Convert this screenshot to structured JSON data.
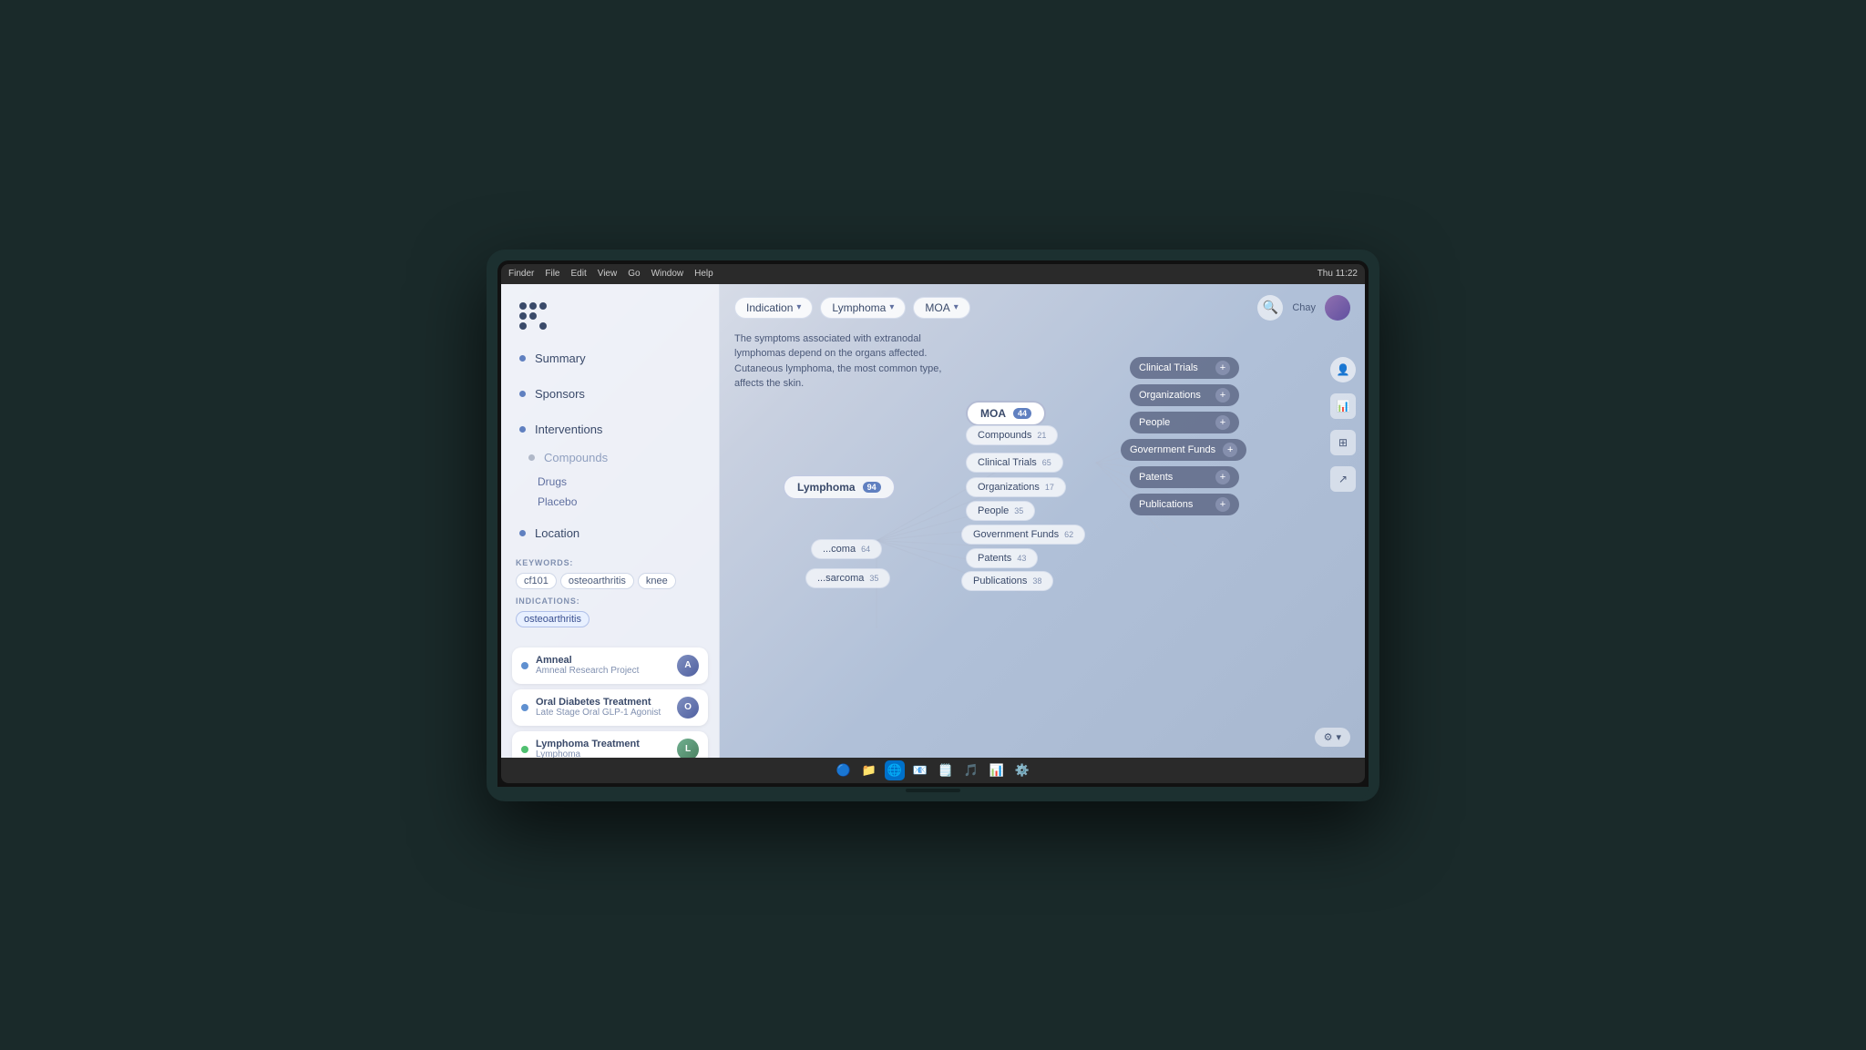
{
  "macos": {
    "menu_items": [
      "Finder",
      "File",
      "Edit",
      "View",
      "Go",
      "Window",
      "Help"
    ],
    "status_right": [
      "Thu 11:22"
    ]
  },
  "sidebar": {
    "nav_items": [
      {
        "label": "Summary",
        "dot": "blue",
        "id": "summary"
      },
      {
        "label": "Sponsors",
        "dot": "blue",
        "id": "sponsors"
      },
      {
        "label": "Interventions",
        "dot": "blue",
        "id": "interventions"
      },
      {
        "label": "Compounds",
        "dot": "gray",
        "id": "compounds"
      },
      {
        "label": "Drugs",
        "dot": "none",
        "id": "drugs"
      },
      {
        "label": "Placebo",
        "dot": "none",
        "id": "placebo"
      },
      {
        "label": "Location",
        "dot": "blue",
        "id": "location"
      }
    ],
    "keywords_label": "KEYWORDS:",
    "keywords": [
      "cf101",
      "osteoarthritis",
      "knee"
    ],
    "indications_label": "INDICATIONS:",
    "indications": [
      "osteoarthritis"
    ],
    "projects": [
      {
        "title": "Amneal",
        "sub": "Amneal Research Project",
        "dot": "blue",
        "avatar": "A"
      },
      {
        "title": "Oral Diabetes Treatment",
        "sub": "Late Stage Oral GLP-1 Agonist",
        "dot": "blue",
        "avatar": "O"
      },
      {
        "title": "Lymphoma Treatment",
        "sub": "Lymphoma",
        "dot": "green",
        "avatar": "L"
      }
    ]
  },
  "header": {
    "filters": [
      {
        "label": "Indication",
        "id": "indication-filter"
      },
      {
        "label": "Lymphoma",
        "id": "lymphoma-filter"
      },
      {
        "label": "MOA",
        "id": "moa-filter"
      }
    ],
    "search_placeholder": "Search",
    "user_name": "Chay"
  },
  "description": {
    "text": "The symptoms associated with extranodal lymphomas depend on the organs affected. Cutaneous lymphoma, the most common type, affects the skin."
  },
  "graph": {
    "center_node": "Lymphoma",
    "center_badge": "94",
    "moa_node": "MOA",
    "moa_badge": "44",
    "left_nodes": [
      {
        "label": "Compounds",
        "badge": "21"
      },
      {
        "label": "Clinical Trials",
        "badge": "65"
      },
      {
        "label": "Organizations",
        "badge": "17"
      },
      {
        "label": "People",
        "badge": "35"
      },
      {
        "label": "Government Funds",
        "badge": "62"
      },
      {
        "label": "Patents",
        "badge": "43"
      },
      {
        "label": "Publications",
        "badge": "38"
      }
    ],
    "right_nodes": [
      {
        "label": "Clinical Trials"
      },
      {
        "label": "Organizations"
      },
      {
        "label": "People"
      },
      {
        "label": "Government Funds"
      },
      {
        "label": "Patents"
      },
      {
        "label": "Publications"
      }
    ],
    "extra_nodes": [
      {
        "label": "...coma",
        "badge": "64"
      },
      {
        "label": "...sarcoma",
        "badge": "35"
      }
    ]
  },
  "settings": {
    "label": "⚙"
  }
}
